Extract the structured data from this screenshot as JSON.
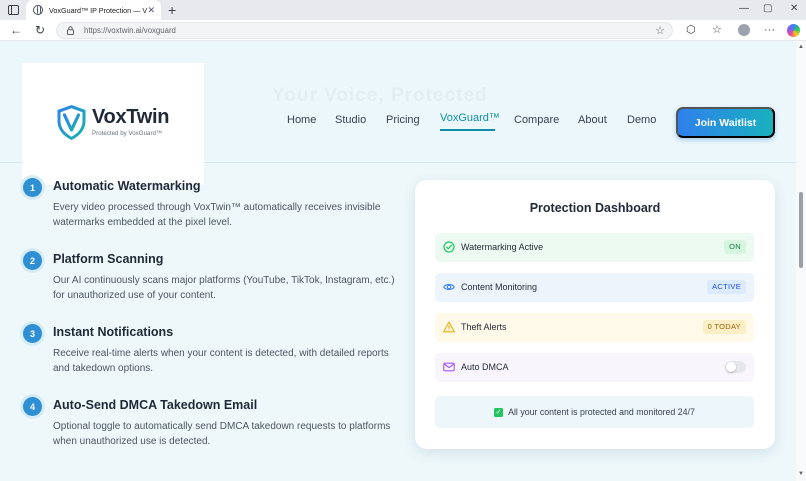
{
  "browser": {
    "tab_title": "VoxGuard™ IP Protection — VoxTwin",
    "tab_close": "✕",
    "new_tab": "+",
    "url": "https://voxtwin.ai/voxguard",
    "window_controls": {
      "minimize": "—",
      "maximize": "▢",
      "close": "✕"
    },
    "nav_icons": {
      "back": "←",
      "refresh": "↻",
      "star": "☆",
      "extensions": "⬡",
      "favorites": "☆",
      "menu": "···"
    }
  },
  "header": {
    "ghost_text": "Your Voice, Protected",
    "logo": {
      "brand": "VoxTwin",
      "tagline": "Protected by VoxGuard™"
    },
    "nav": [
      "Home",
      "Studio",
      "Pricing",
      "VoxGuard™",
      "Compare",
      "About",
      "Demo"
    ],
    "active_nav": "VoxGuard™",
    "cta": "Join Waitlist"
  },
  "features": [
    {
      "number": "1",
      "title": "Automatic Watermarking",
      "description": "Every video processed through VoxTwin™ automatically receives invisible watermarks embedded at the pixel level."
    },
    {
      "number": "2",
      "title": "Platform Scanning",
      "description": "Our AI continuously scans major platforms (YouTube, TikTok, Instagram, etc.) for unauthorized use of your content."
    },
    {
      "number": "3",
      "title": "Instant Notifications",
      "description": "Receive real-time alerts when your content is detected, with detailed reports and takedown options."
    },
    {
      "number": "4",
      "title": "Auto-Send DMCA Takedown Email",
      "description": "Optional toggle to automatically send DMCA takedown requests to platforms when unauthorized use is detected."
    }
  ],
  "dashboard": {
    "title": "Protection Dashboard",
    "rows": [
      {
        "label": "Watermarking Active",
        "badge": "ON",
        "icon": "check-circle-icon",
        "color": "#22c55e"
      },
      {
        "label": "Content Monitoring",
        "badge": "ACTIVE",
        "icon": "eye-icon",
        "color": "#3b82f6"
      },
      {
        "label": "Theft Alerts",
        "badge": "0 TODAY",
        "icon": "warning-icon",
        "color": "#eab308"
      },
      {
        "label": "Auto DMCA",
        "toggle_on": false,
        "icon": "mail-icon",
        "color": "#a855f7"
      }
    ],
    "status_check": "✓",
    "status": "All your content is protected and monitored 24/7"
  },
  "colors": {
    "brand_teal": "#0f8fa6",
    "cta_start": "#2f80ed",
    "cta_end": "#19b1be",
    "step_blue": "#2f8fd4"
  }
}
